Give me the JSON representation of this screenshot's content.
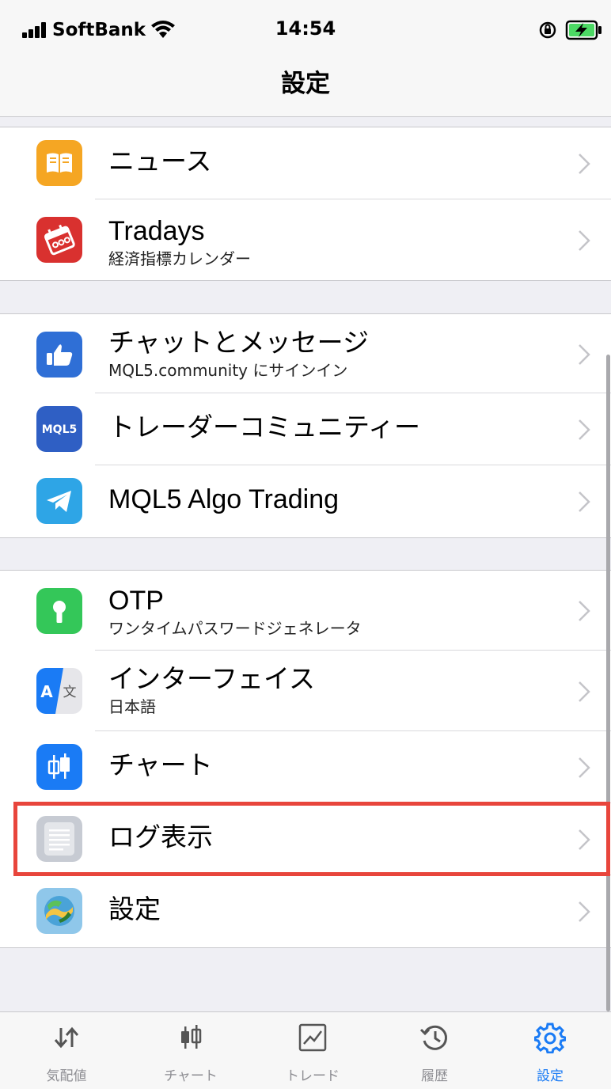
{
  "status_bar": {
    "carrier": "SoftBank",
    "time": "14:54"
  },
  "nav": {
    "title": "設定"
  },
  "groups": [
    {
      "items": [
        {
          "title": "ニュース",
          "icon": "book-icon",
          "icon_color": "#f5a623"
        },
        {
          "title": "Tradays",
          "subtitle": "経済指標カレンダー",
          "icon": "calendar-icon",
          "icon_color": "#d9312f"
        }
      ]
    },
    {
      "items": [
        {
          "title": "チャットとメッセージ",
          "subtitle": "MQL5.community にサインイン",
          "icon": "thumbs-up-icon",
          "icon_color": "#2f6fd6"
        },
        {
          "title": "トレーダーコミュニティー",
          "icon": "mql5-icon",
          "icon_color": "#2f5fc4",
          "icon_text": "MQL5"
        },
        {
          "title": "MQL5 Algo Trading",
          "icon": "telegram-icon",
          "icon_color": "#2ea5e6"
        }
      ]
    },
    {
      "items": [
        {
          "title": "OTP",
          "subtitle": "ワンタイムパスワードジェネレータ",
          "icon": "key-icon",
          "icon_color": "#34c759"
        },
        {
          "title": "インターフェイス",
          "subtitle": "日本語",
          "icon": "translate-icon",
          "icon_color": "#1a7bf5",
          "icon_text_a": "A",
          "icon_text_b": "文"
        },
        {
          "title": "チャート",
          "icon": "candlestick-icon",
          "icon_color": "#1a7bf5"
        },
        {
          "title": "ログ表示",
          "icon": "log-icon",
          "icon_color": "#c7cbd3",
          "highlighted": true
        },
        {
          "title": "設定",
          "icon": "metatrader-icon",
          "icon_color": "#8fc7ea"
        }
      ]
    }
  ],
  "tab_bar": {
    "active_color": "#1a7bf5",
    "tabs": [
      {
        "label": "気配値",
        "icon": "quotes-arrows-icon"
      },
      {
        "label": "チャート",
        "icon": "chart-candles-icon"
      },
      {
        "label": "トレード",
        "icon": "trade-chart-icon"
      },
      {
        "label": "履歴",
        "icon": "history-clock-icon"
      },
      {
        "label": "設定",
        "icon": "settings-gear-icon",
        "active": true
      }
    ]
  }
}
